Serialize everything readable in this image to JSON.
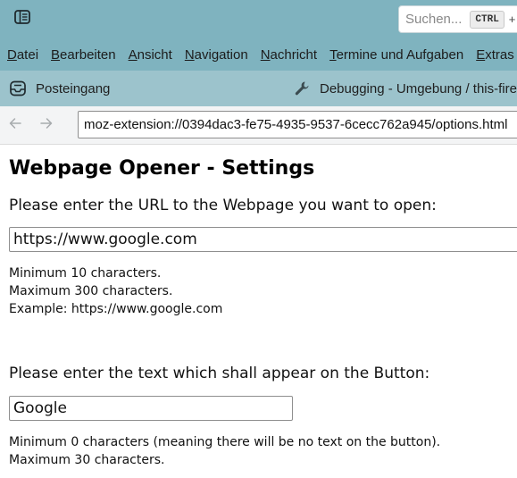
{
  "titlebar": {
    "search_placeholder": "Suchen...",
    "search_shortcut_key": "CTRL",
    "search_shortcut_plus": "+",
    "background_color": "#7fb3bf",
    "icons": {
      "app_menu": "sidebar-icon"
    }
  },
  "menubar": {
    "items": [
      {
        "label": "Datei"
      },
      {
        "label": "Bearbeiten"
      },
      {
        "label": "Ansicht"
      },
      {
        "label": "Navigation"
      },
      {
        "label": "Nachricht"
      },
      {
        "label": "Termine und Aufgaben"
      },
      {
        "label": "Extras"
      }
    ]
  },
  "tabs": [
    {
      "label": "Posteingang",
      "icon": "inbox-icon"
    },
    {
      "label": "Debugging - Umgebung / this-fire",
      "icon": "wrench-icon"
    }
  ],
  "navbar": {
    "url": "moz-extension://0394dac3-fe75-4935-9537-6cecc762a945/options.html",
    "icons": {
      "back": "arrow-left-icon",
      "forward": "arrow-right-icon"
    }
  },
  "page": {
    "title": "Webpage Opener - Settings",
    "url_section": {
      "prompt": "Please enter the URL to the Webpage you want to open:",
      "value": "https://www.google.com",
      "hints": [
        "Minimum 10 characters.",
        "Maximum 300 characters.",
        "Example: https://www.google.com"
      ]
    },
    "button_section": {
      "prompt": "Please enter the text which shall appear on the Button:",
      "value": "Google",
      "hints": [
        "Minimum 0 characters (meaning there will be no text on the button).",
        "Maximum 30 characters."
      ]
    }
  }
}
